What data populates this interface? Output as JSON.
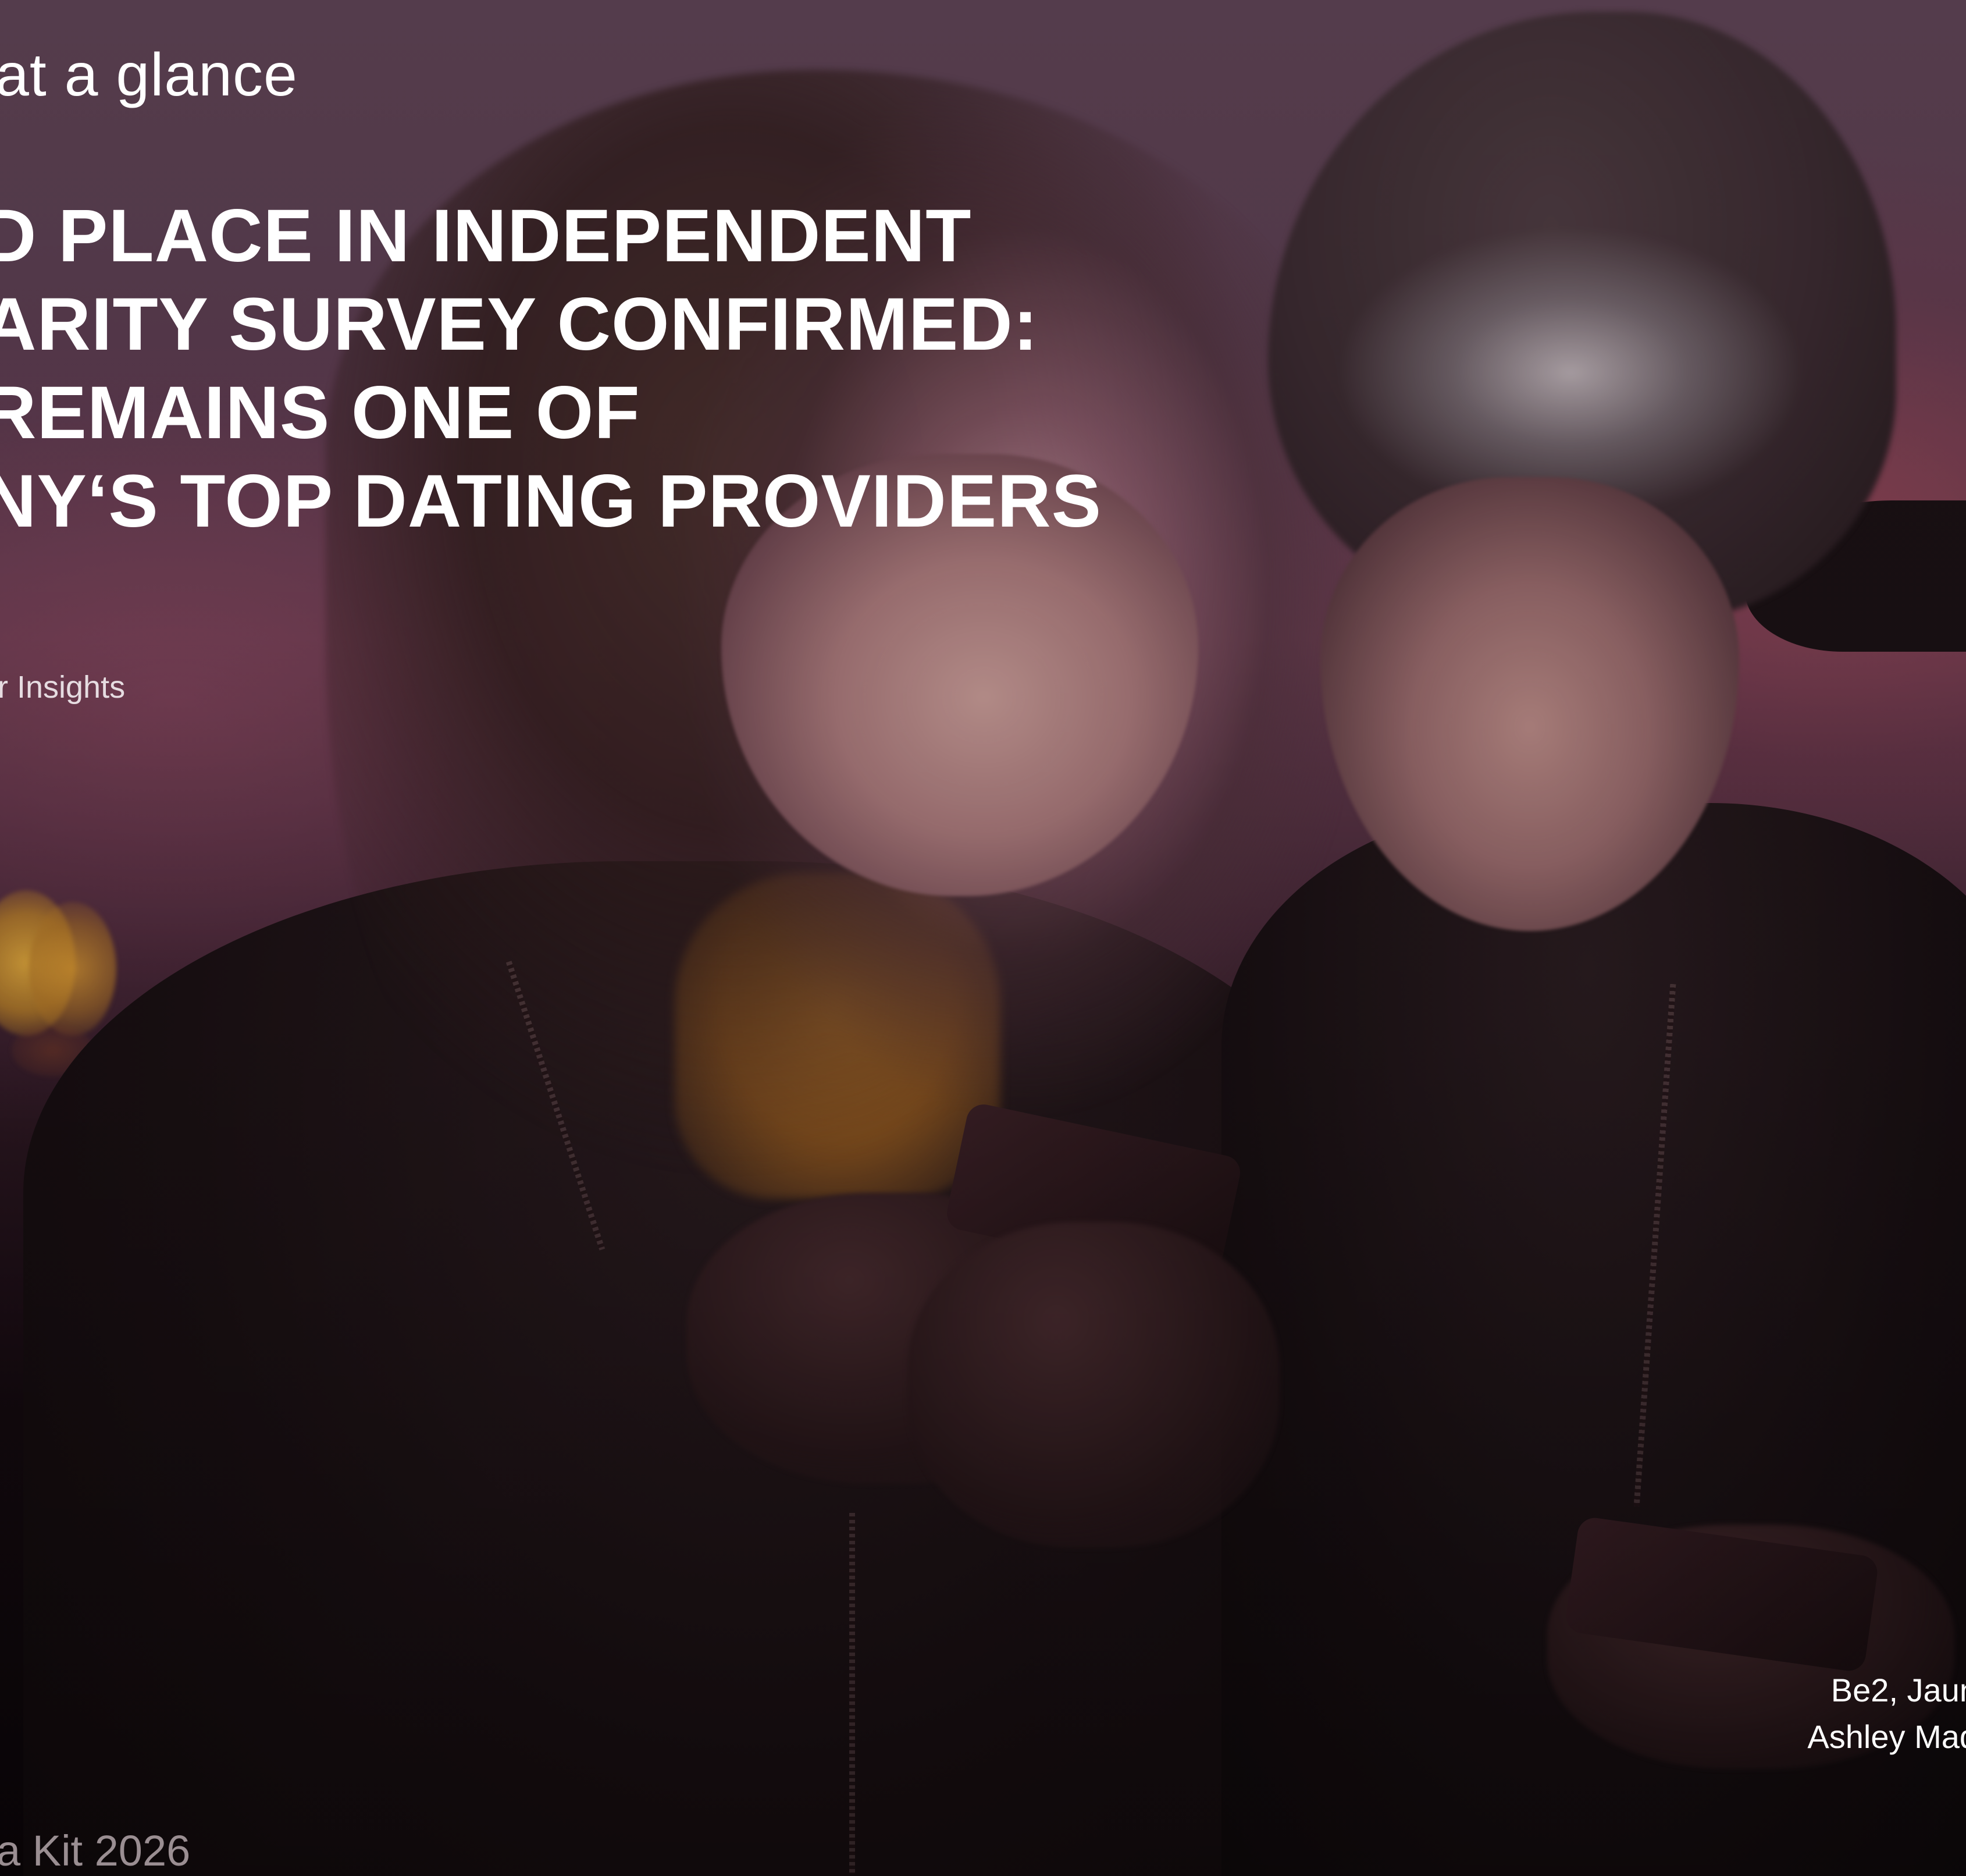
{
  "page": {
    "eyebrow": "at a glance",
    "headline_lines": [
      "D PLACE IN INDEPENDENT",
      "ARITY SURVEY CONFIRMED:",
      "REMAINS ONE OF",
      "NY‘S TOP DATING PROVIDERS"
    ],
    "subline": "r Insights",
    "caption_lines": [
      "Be2, Jaun",
      "Ashley Mad"
    ],
    "footer": "a Kit 2026"
  },
  "colors": {
    "text_primary": "#ffffff",
    "text_muted": "#9a8e92",
    "bokeh_warm": "#e2aa3c",
    "sky_tone": "#5b4152"
  }
}
